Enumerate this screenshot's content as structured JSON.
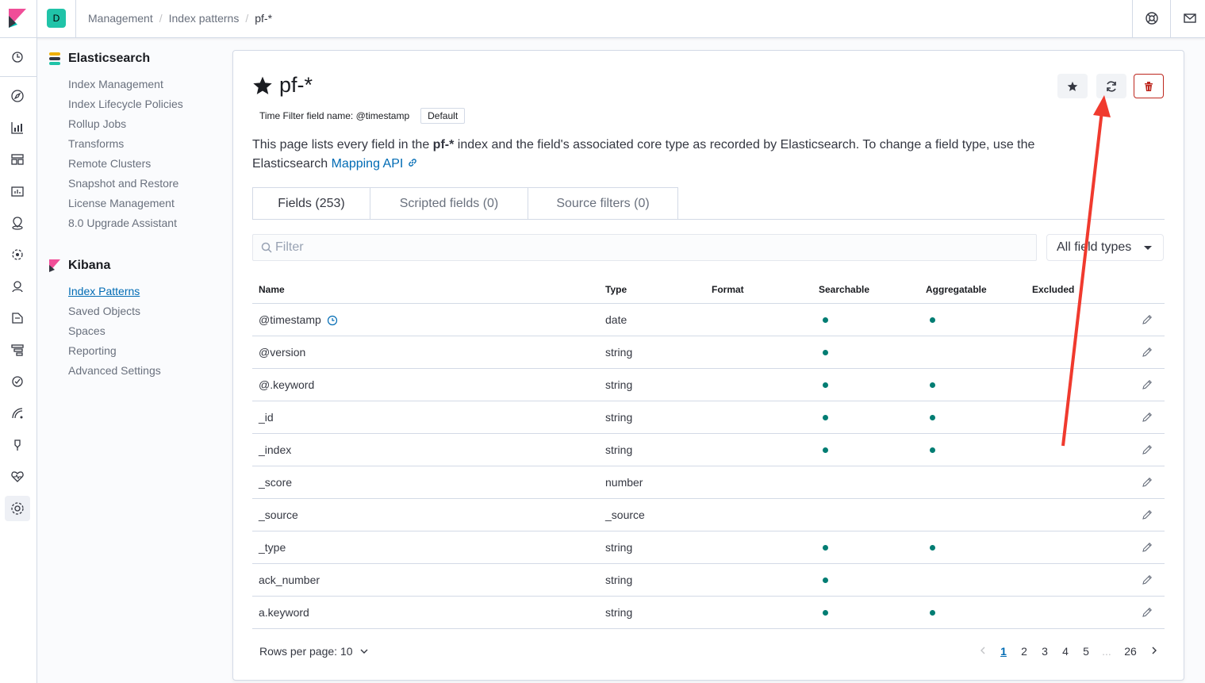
{
  "header": {
    "space_initial": "D",
    "breadcrumbs": [
      "Management",
      "Index patterns",
      "pf-*"
    ]
  },
  "sidebar": {
    "sections": [
      {
        "title": "Elasticsearch",
        "items": [
          "Index Management",
          "Index Lifecycle Policies",
          "Rollup Jobs",
          "Transforms",
          "Remote Clusters",
          "Snapshot and Restore",
          "License Management",
          "8.0 Upgrade Assistant"
        ]
      },
      {
        "title": "Kibana",
        "items": [
          "Index Patterns",
          "Saved Objects",
          "Spaces",
          "Reporting",
          "Advanced Settings"
        ],
        "active_index": 0
      }
    ]
  },
  "page": {
    "title": "pf-*",
    "time_filter_label": "Time Filter field name: @timestamp",
    "default_badge": "Default",
    "desc_prefix": "This page lists every field in the ",
    "desc_bold": "pf-*",
    "desc_middle": " index and the field's associated core type as recorded by Elasticsearch. To change a field type, use the Elasticsearch ",
    "desc_link": "Mapping API",
    "tabs": [
      "Fields (253)",
      "Scripted fields (0)",
      "Source filters (0)"
    ],
    "filter_placeholder": "Filter",
    "field_type_select": "All field types"
  },
  "table": {
    "columns": [
      "Name",
      "Type",
      "Format",
      "Searchable",
      "Aggregatable",
      "Excluded"
    ],
    "rows": [
      {
        "name": "@timestamp",
        "type": "date",
        "searchable": true,
        "aggregatable": true,
        "time_icon": true
      },
      {
        "name": "@version",
        "type": "string",
        "searchable": true,
        "aggregatable": false
      },
      {
        "name": "@.keyword",
        "type": "string",
        "searchable": true,
        "aggregatable": true
      },
      {
        "name": "_id",
        "type": "string",
        "searchable": true,
        "aggregatable": true
      },
      {
        "name": "_index",
        "type": "string",
        "searchable": true,
        "aggregatable": true
      },
      {
        "name": "_score",
        "type": "number",
        "searchable": false,
        "aggregatable": false
      },
      {
        "name": "_source",
        "type": "_source",
        "searchable": false,
        "aggregatable": false
      },
      {
        "name": "_type",
        "type": "string",
        "searchable": true,
        "aggregatable": true
      },
      {
        "name": "ack_number",
        "type": "string",
        "searchable": true,
        "aggregatable": false
      },
      {
        "name": "a.keyword",
        "type": "string",
        "searchable": true,
        "aggregatable": true
      }
    ]
  },
  "pagination": {
    "rows_per_page": "Rows per page: 10",
    "pages": [
      "1",
      "2",
      "3",
      "4",
      "5",
      "...",
      "26"
    ],
    "current": "1"
  },
  "colors": {
    "accent": "#006bb4",
    "dot": "#017d73",
    "danger": "#bd271e",
    "annotation_arrow": "#f03a2e"
  }
}
